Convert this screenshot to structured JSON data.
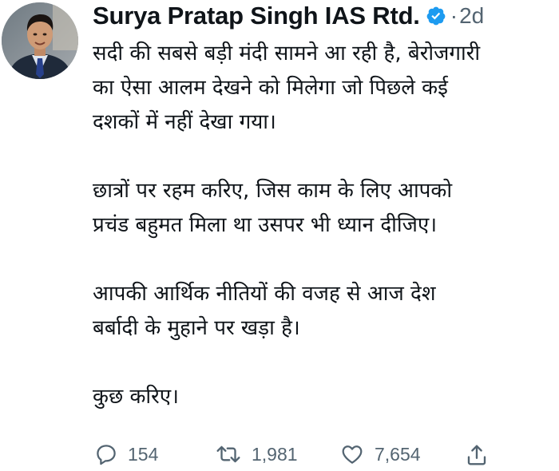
{
  "tweet": {
    "author": {
      "display_name": "Surya Pratap Singh IAS Rtd.",
      "verified": true,
      "avatar_icon": "person-avatar"
    },
    "separator": "·",
    "timestamp": "2d",
    "lines": [
      "सदी की सबसे बड़ी मंदी सामने आ रही है, बेरोजगारी",
      "का ऐसा आलम देखने को मिलेगा जो पिछले कई",
      "दशकों में नहीं देखा गया।",
      "",
      "छात्रों पर रहम करिए, जिस काम के लिए आपको",
      "प्रचंड बहुमत मिला था उसपर भी ध्यान दीजिए।",
      "",
      "आपकी आर्थिक नीतियों की वजह से आज देश",
      "बर्बादी के मुहाने पर खड़ा है।",
      "",
      "कुछ करिए।"
    ],
    "actions": {
      "reply_count": "154",
      "retweet_count": "1,981",
      "like_count": "7,654"
    },
    "colors": {
      "text": "#0f1419",
      "muted": "#536471",
      "verified": "#1d9bf0"
    }
  }
}
